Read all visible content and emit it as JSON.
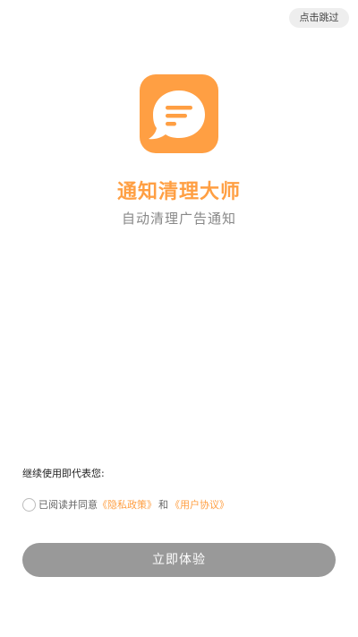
{
  "header": {
    "skip_label": "点击跳过"
  },
  "splash": {
    "icon": "chat-bubble-icon",
    "app_name": "通知清理大师",
    "slogan": "自动清理广告通知"
  },
  "agreement": {
    "continue_text": "继续使用即代表您:",
    "read_agree_text": "已阅读并同意",
    "privacy_link": "《隐私政策》",
    "and_text": "和",
    "user_link": "《用户协议》",
    "checked": false
  },
  "footer": {
    "start_label": "立即体验"
  },
  "colors": {
    "accent": "#FF9F43",
    "button_disabled": "#999999",
    "skip_bg": "#eeeeee"
  }
}
